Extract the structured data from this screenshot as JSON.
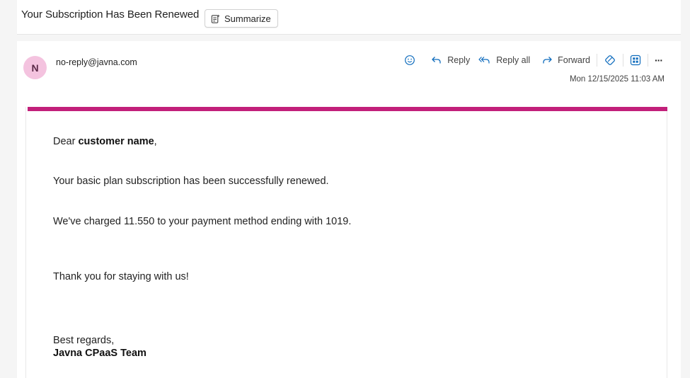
{
  "subject": "Your Subscription Has Been Renewed",
  "summarize_label": "Summarize",
  "sender": {
    "initial": "N",
    "email": "no-reply@javna.com"
  },
  "actions": {
    "reply": "Reply",
    "reply_all": "Reply all",
    "forward": "Forward",
    "more": "···"
  },
  "date": "Mon 12/15/2025 11:03 AM",
  "colors": {
    "accent": "#c2207a",
    "avatar_bg": "#f4c3df",
    "link_blue": "#0f6cbd"
  },
  "body": {
    "greeting_prefix": "Dear ",
    "greeting_name": "customer name",
    "greeting_suffix": ",",
    "line1": "Your basic plan subscription has been successfully renewed.",
    "line2": "We've charged 11.550 to your payment method ending with 1019.",
    "line3": "Thank you for staying with us!",
    "closing": "Best regards,",
    "signature": "Javna CPaaS Team"
  }
}
